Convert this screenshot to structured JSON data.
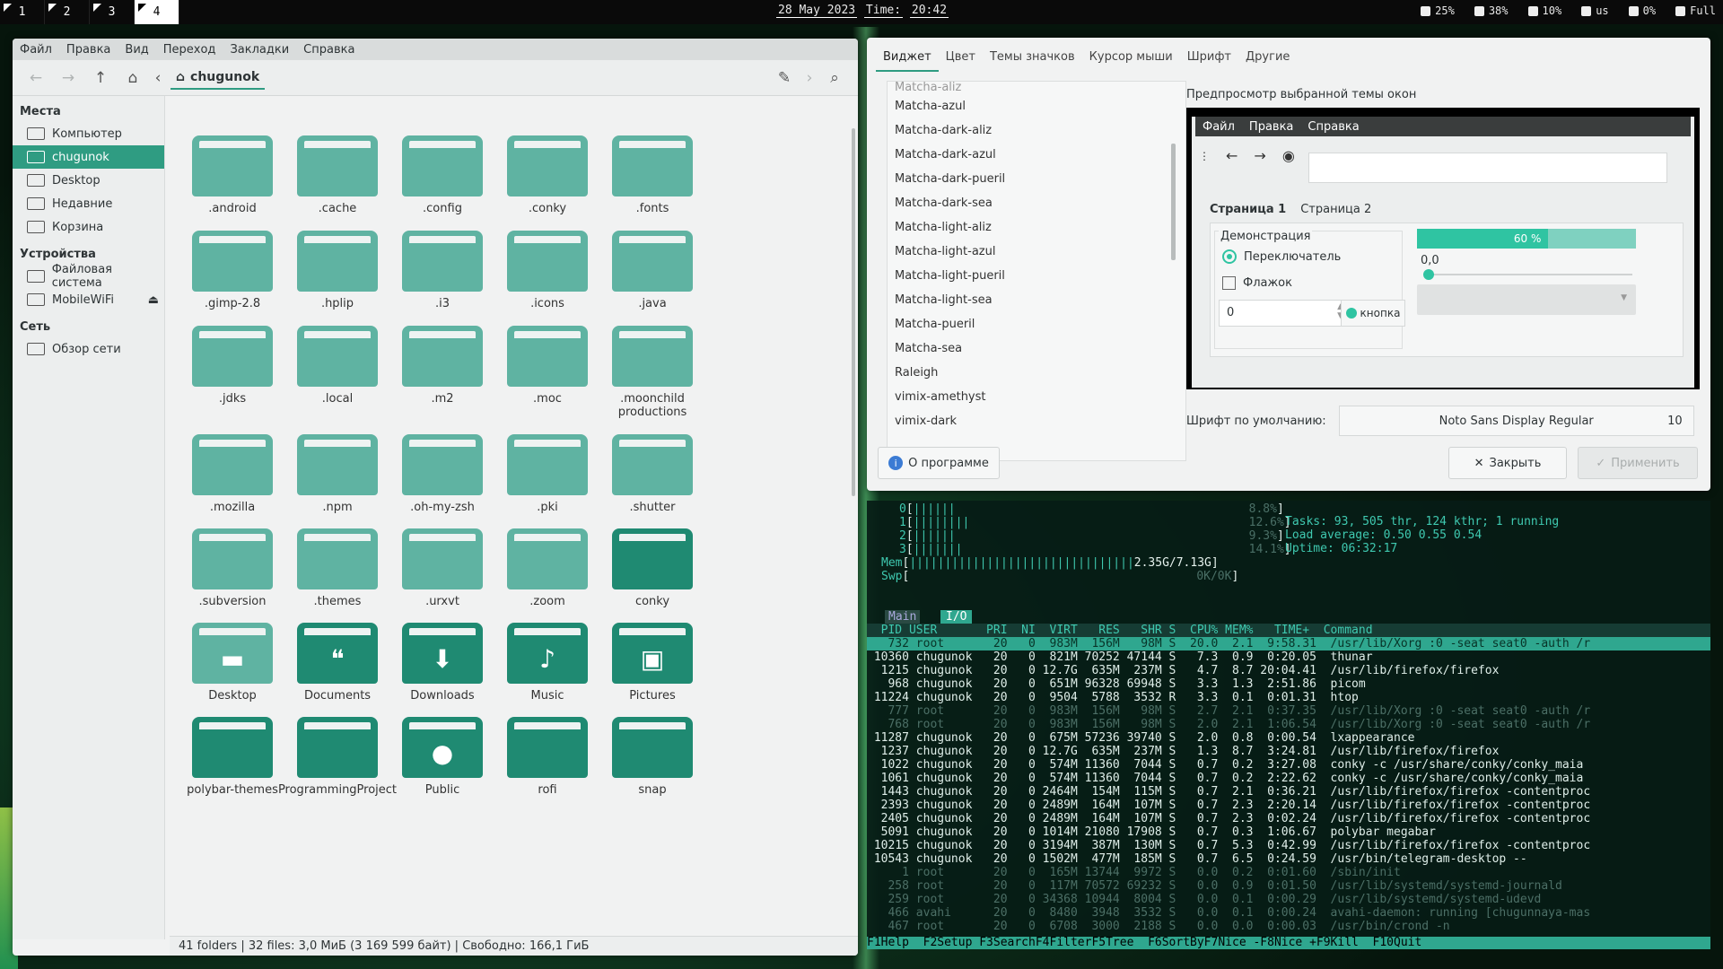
{
  "topbar": {
    "workspaces": [
      "1",
      "2",
      "3",
      "4"
    ],
    "active_workspace": "4",
    "date": "28 May 2023",
    "time_label": "Time:",
    "time": "20:42",
    "status": [
      {
        "icon": "folder-icon",
        "text": "25%"
      },
      {
        "icon": "cpu-icon",
        "text": "38%"
      },
      {
        "icon": "memory-icon",
        "text": "10%"
      },
      {
        "icon": "keyboard-icon",
        "text": "us"
      },
      {
        "icon": "volume-icon",
        "text": "0%"
      },
      {
        "icon": "battery-icon",
        "text": "Full"
      }
    ]
  },
  "fm": {
    "menu": [
      "Файл",
      "Правка",
      "Вид",
      "Переход",
      "Закладки",
      "Справка"
    ],
    "path": "chugunok",
    "sidebar": {
      "places_h": "Места",
      "places": [
        "Компьютер",
        "chugunok",
        "Desktop",
        "Недавние",
        "Корзина"
      ],
      "devices_h": "Устройства",
      "devices": [
        "Файловая система",
        "MobileWiFi"
      ],
      "net_h": "Сеть",
      "net": [
        "Обзор сети"
      ]
    },
    "files": [
      ".android",
      ".cache",
      ".config",
      ".conky",
      ".fonts",
      ".gimp-2.8",
      ".hplip",
      ".i3",
      ".icons",
      ".java",
      ".jdks",
      ".local",
      ".m2",
      ".moc",
      ".moonchild productions",
      ".mozilla",
      ".npm",
      ".oh-my-zsh",
      ".pki",
      ".shutter",
      ".subversion",
      ".themes",
      ".urxvt",
      ".zoom",
      "conky",
      "Desktop",
      "Documents",
      "Downloads",
      "Music",
      "Pictures",
      "polybar-themes",
      "ProgrammingProject",
      "Public",
      "rofi",
      "snap"
    ],
    "status": "41 folders  |  32 files: 3,0 МиБ (3 169 599 байт)  |  Свободно: 166,1 ГиБ"
  },
  "lx": {
    "tabs": [
      "Виджет",
      "Цвет",
      "Темы значков",
      "Курсор мыши",
      "Шрифт",
      "Другие"
    ],
    "themes": [
      "Matcha-aliz",
      "Matcha-azul",
      "Matcha-dark-aliz",
      "Matcha-dark-azul",
      "Matcha-dark-pueril",
      "Matcha-dark-sea",
      "Matcha-light-aliz",
      "Matcha-light-azul",
      "Matcha-light-pueril",
      "Matcha-light-sea",
      "Matcha-pueril",
      "Matcha-sea",
      "Raleigh",
      "vimix-amethyst",
      "vimix-dark"
    ],
    "preview_label": "Предпросмотр выбранной темы окон",
    "preview": {
      "menu": [
        "Файл",
        "Правка",
        "Справка"
      ],
      "tab1": "Страница 1",
      "tab2": "Страница 2",
      "demo": "Демонстрация",
      "radio": "Переключатель",
      "check": "Флажок",
      "spin": "0",
      "button": "кнопка",
      "progress": "60 %",
      "slider": "0,0"
    },
    "font_label": "Шрифт по умолчанию:",
    "font": "Noto Sans Display Regular",
    "font_size": "10",
    "about": "О программе",
    "close": "Закрыть",
    "apply": "Применить"
  },
  "htop": {
    "cpu": [
      {
        "n": "0",
        "pct": "8.8%"
      },
      {
        "n": "1",
        "pct": "12.6%"
      },
      {
        "n": "2",
        "pct": "9.3%"
      },
      {
        "n": "3",
        "pct": "14.1%"
      }
    ],
    "mem": "2.35G/7.13G",
    "swp": "0K/0K",
    "tasks": "Tasks: 93, 505 thr, 124 kthr; 1 running",
    "load": "Load average: 0.50 0.55 0.54",
    "uptime": "Uptime: 06:32:17",
    "tab_main": "Main",
    "tab_io": "I/O",
    "header": "  PID USER       PRI  NI  VIRT   RES   SHR S  CPU% MEM%   TIME+  Command",
    "rows": [
      [
        "732",
        "root",
        "20",
        "0",
        "983M",
        "156M",
        "98M",
        "S",
        "20.0",
        "2.1",
        "9:58.31",
        "/usr/lib/Xorg :0 -seat seat0 -auth /r"
      ],
      [
        "10360",
        "chugunok",
        "20",
        "0",
        "821M",
        "70252",
        "47144",
        "S",
        "7.3",
        "0.9",
        "0:20.05",
        "thunar"
      ],
      [
        "1215",
        "chugunok",
        "20",
        "0",
        "12.7G",
        "635M",
        "237M",
        "S",
        "4.7",
        "8.7",
        "20:04.41",
        "/usr/lib/firefox/firefox"
      ],
      [
        "968",
        "chugunok",
        "20",
        "0",
        "651M",
        "96328",
        "69948",
        "S",
        "3.3",
        "1.3",
        "2:51.86",
        "picom"
      ],
      [
        "11224",
        "chugunok",
        "20",
        "0",
        "9504",
        "5788",
        "3532",
        "R",
        "3.3",
        "0.1",
        "0:01.31",
        "htop"
      ],
      [
        "777",
        "root",
        "20",
        "0",
        "983M",
        "156M",
        "98M",
        "S",
        "2.7",
        "2.1",
        "0:37.35",
        "/usr/lib/Xorg :0 -seat seat0 -auth /r"
      ],
      [
        "768",
        "root",
        "20",
        "0",
        "983M",
        "156M",
        "98M",
        "S",
        "2.0",
        "2.1",
        "1:06.54",
        "/usr/lib/Xorg :0 -seat seat0 -auth /r"
      ],
      [
        "11287",
        "chugunok",
        "20",
        "0",
        "675M",
        "57236",
        "39740",
        "S",
        "2.0",
        "0.8",
        "0:00.54",
        "lxappearance"
      ],
      [
        "1237",
        "chugunok",
        "20",
        "0",
        "12.7G",
        "635M",
        "237M",
        "S",
        "1.3",
        "8.7",
        "3:24.81",
        "/usr/lib/firefox/firefox"
      ],
      [
        "1022",
        "chugunok",
        "20",
        "0",
        "574M",
        "11360",
        "7044",
        "S",
        "0.7",
        "0.2",
        "3:27.08",
        "conky -c /usr/share/conky/conky_maia"
      ],
      [
        "1061",
        "chugunok",
        "20",
        "0",
        "574M",
        "11360",
        "7044",
        "S",
        "0.7",
        "0.2",
        "2:22.62",
        "conky -c /usr/share/conky/conky_maia"
      ],
      [
        "1443",
        "chugunok",
        "20",
        "0",
        "2464M",
        "154M",
        "115M",
        "S",
        "0.7",
        "2.1",
        "0:36.21",
        "/usr/lib/firefox/firefox -contentproc"
      ],
      [
        "2393",
        "chugunok",
        "20",
        "0",
        "2489M",
        "164M",
        "107M",
        "S",
        "0.7",
        "2.3",
        "2:20.14",
        "/usr/lib/firefox/firefox -contentproc"
      ],
      [
        "2405",
        "chugunok",
        "20",
        "0",
        "2489M",
        "164M",
        "107M",
        "S",
        "0.7",
        "2.3",
        "0:02.24",
        "/usr/lib/firefox/firefox -contentproc"
      ],
      [
        "5091",
        "chugunok",
        "20",
        "0",
        "1014M",
        "21080",
        "17908",
        "S",
        "0.7",
        "0.3",
        "1:06.67",
        "polybar megabar"
      ],
      [
        "10215",
        "chugunok",
        "20",
        "0",
        "3194M",
        "387M",
        "130M",
        "S",
        "0.7",
        "5.3",
        "0:42.99",
        "/usr/lib/firefox/firefox -contentproc"
      ],
      [
        "10543",
        "chugunok",
        "20",
        "0",
        "1502M",
        "477M",
        "185M",
        "S",
        "0.7",
        "6.5",
        "0:24.59",
        "/usr/bin/telegram-desktop --"
      ],
      [
        "1",
        "root",
        "20",
        "0",
        "165M",
        "13744",
        "9972",
        "S",
        "0.0",
        "0.2",
        "0:01.60",
        "/sbin/init"
      ],
      [
        "258",
        "root",
        "20",
        "0",
        "117M",
        "70572",
        "69232",
        "S",
        "0.0",
        "0.9",
        "0:01.50",
        "/usr/lib/systemd/systemd-journald"
      ],
      [
        "259",
        "root",
        "20",
        "0",
        "34368",
        "10944",
        "8004",
        "S",
        "0.0",
        "0.1",
        "0:00.29",
        "/usr/lib/systemd/systemd-udevd"
      ],
      [
        "466",
        "avahi",
        "20",
        "0",
        "8480",
        "3948",
        "3532",
        "S",
        "0.0",
        "0.1",
        "0:00.24",
        "avahi-daemon: running [chugunnaya-mas"
      ],
      [
        "467",
        "root",
        "20",
        "0",
        "6708",
        "3000",
        "2188",
        "S",
        "0.0",
        "0.0",
        "0:00.03",
        "/usr/bin/crond -n"
      ]
    ],
    "footer": "F1Help  F2Setup F3SearchF4FilterF5Tree  F6SortByF7Nice -F8Nice +F9Kill  F10Quit"
  }
}
